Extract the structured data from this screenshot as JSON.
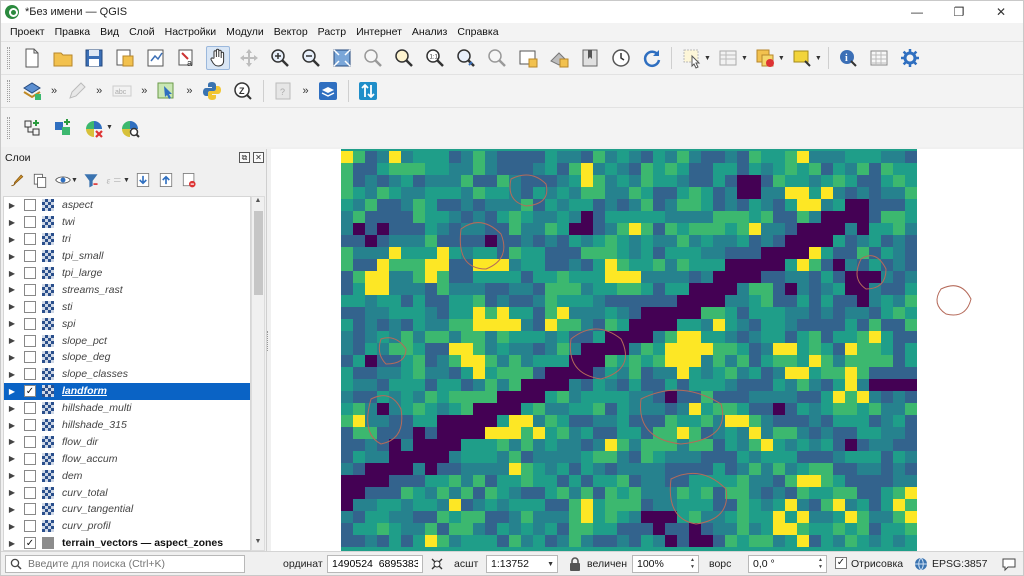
{
  "window": {
    "title": "*Без имени — QGIS",
    "controls": {
      "minimize": "—",
      "maximize": "❐",
      "close": "✕"
    }
  },
  "menu": [
    "Проект",
    "Правка",
    "Вид",
    "Слой",
    "Настройки",
    "Модули",
    "Вектор",
    "Растр",
    "Интернет",
    "Анализ",
    "Справка"
  ],
  "layers_panel": {
    "title": "Слои",
    "layers": [
      {
        "name": "aspect",
        "checked": false,
        "type": "raster",
        "selected": false
      },
      {
        "name": "twi",
        "checked": false,
        "type": "raster",
        "selected": false
      },
      {
        "name": "tri",
        "checked": false,
        "type": "raster",
        "selected": false
      },
      {
        "name": "tpi_small",
        "checked": false,
        "type": "raster",
        "selected": false
      },
      {
        "name": "tpi_large",
        "checked": false,
        "type": "raster",
        "selected": false
      },
      {
        "name": "streams_rast",
        "checked": false,
        "type": "raster",
        "selected": false
      },
      {
        "name": "sti",
        "checked": false,
        "type": "raster",
        "selected": false
      },
      {
        "name": "spi",
        "checked": false,
        "type": "raster",
        "selected": false
      },
      {
        "name": "slope_pct",
        "checked": false,
        "type": "raster",
        "selected": false
      },
      {
        "name": "slope_deg",
        "checked": false,
        "type": "raster",
        "selected": false
      },
      {
        "name": "slope_classes",
        "checked": false,
        "type": "raster",
        "selected": false
      },
      {
        "name": "landform",
        "checked": true,
        "type": "raster",
        "selected": true
      },
      {
        "name": "hillshade_multi",
        "checked": false,
        "type": "raster",
        "selected": false
      },
      {
        "name": "hillshade_315",
        "checked": false,
        "type": "raster",
        "selected": false
      },
      {
        "name": "flow_dir",
        "checked": false,
        "type": "raster",
        "selected": false
      },
      {
        "name": "flow_accum",
        "checked": false,
        "type": "raster",
        "selected": false
      },
      {
        "name": "dem",
        "checked": false,
        "type": "raster",
        "selected": false
      },
      {
        "name": "curv_total",
        "checked": false,
        "type": "raster",
        "selected": false
      },
      {
        "name": "curv_tangential",
        "checked": false,
        "type": "raster",
        "selected": false
      },
      {
        "name": "curv_profil",
        "checked": false,
        "type": "raster",
        "selected": false
      },
      {
        "name": "terrain_vectors — aspect_zones",
        "checked": true,
        "type": "vector",
        "selected": false
      }
    ]
  },
  "statusbar": {
    "search_placeholder": "Введите для поиска (Ctrl+K)",
    "coordinate_label": "ординат",
    "coordinate_value": "1490524  6895383",
    "scale_label": "асшт",
    "scale_value": "1:13752",
    "magnifier_label": "величен",
    "magnifier_value": "100%",
    "rotation_label": "ворс",
    "rotation_value": "0,0 °",
    "render_label": "Отрисовка",
    "render_checked": true,
    "crs": "EPSG:3857"
  },
  "map": {
    "palette": [
      "#440154",
      "#33638d",
      "#26828e",
      "#1f9e89",
      "#3cb86f",
      "#fde725"
    ]
  },
  "icons": [
    "new-project-icon",
    "open-project-icon",
    "save-project-icon",
    "pan-hand-icon",
    "zoom-in-icon",
    "zoom-out-icon",
    "identify-icon",
    "python-icon",
    "refresh-icon"
  ]
}
